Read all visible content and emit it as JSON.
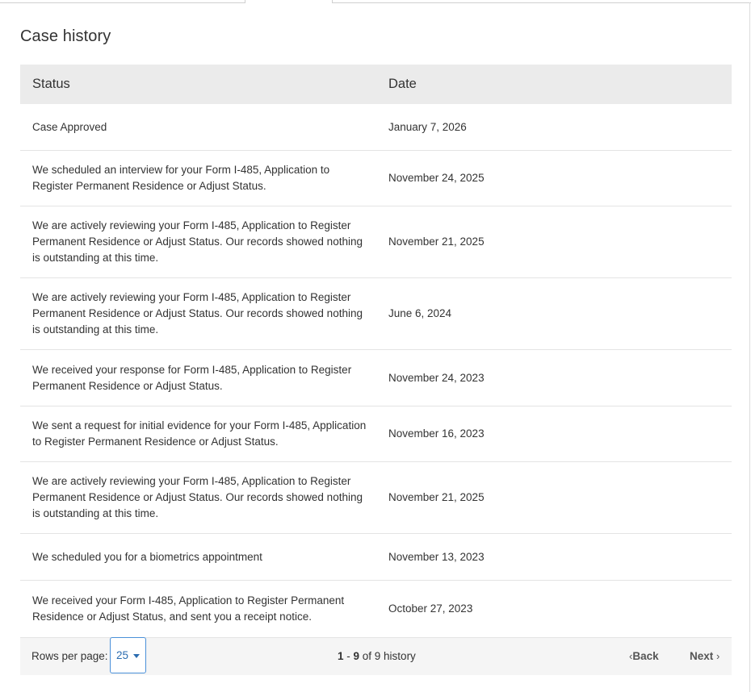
{
  "panel": {
    "title": "Case history"
  },
  "table": {
    "headers": {
      "status": "Status",
      "date": "Date"
    },
    "rows": [
      {
        "status": "Case Approved",
        "date": "January 7, 2026"
      },
      {
        "status": "We scheduled an interview for your Form I-485, Application to Register Permanent Residence or Adjust Status.",
        "date": "November 24, 2025"
      },
      {
        "status": "We are actively reviewing your Form I-485, Application to Register Permanent Residence or Adjust Status. Our records showed nothing is outstanding at this time.",
        "date": "November 21, 2025"
      },
      {
        "status": "We are actively reviewing your Form I-485, Application to Register Permanent Residence or Adjust Status. Our records showed nothing is outstanding at this time.",
        "date": "June 6, 2024"
      },
      {
        "status": "We received your response for Form I-485, Application to Register Permanent Residence or Adjust Status.",
        "date": "November 24, 2023"
      },
      {
        "status": "We sent a request for initial evidence for your Form I-485, Application to Register Permanent Residence or Adjust Status.",
        "date": "November 16, 2023"
      },
      {
        "status": "We are actively reviewing your Form I-485, Application to Register Permanent Residence or Adjust Status. Our records showed nothing is outstanding at this time.",
        "date": "November 21, 2025"
      },
      {
        "status": "We scheduled you for a biometrics appointment",
        "date": "November 13, 2023"
      },
      {
        "status": "We received your Form I-485, Application to Register Permanent Residence or Adjust Status, and sent you a receipt notice.",
        "date": "October 27, 2023"
      }
    ]
  },
  "pagination": {
    "rows_per_page_label": "Rows per page:",
    "rows_per_page_value": "25",
    "range_start": "1",
    "range_sep": " - ",
    "range_end": "9",
    "range_suffix": " of 9 history",
    "back_label": "Back",
    "next_label": "Next"
  },
  "icons": {
    "select_caret": "chevron-down-icon",
    "back": "chevron-left-icon",
    "next": "chevron-right-icon"
  },
  "colors": {
    "header_bg": "#ebebeb",
    "footer_bg": "#f5f5f5",
    "select_border": "#4a90d9",
    "select_text": "#2b6cb0"
  }
}
